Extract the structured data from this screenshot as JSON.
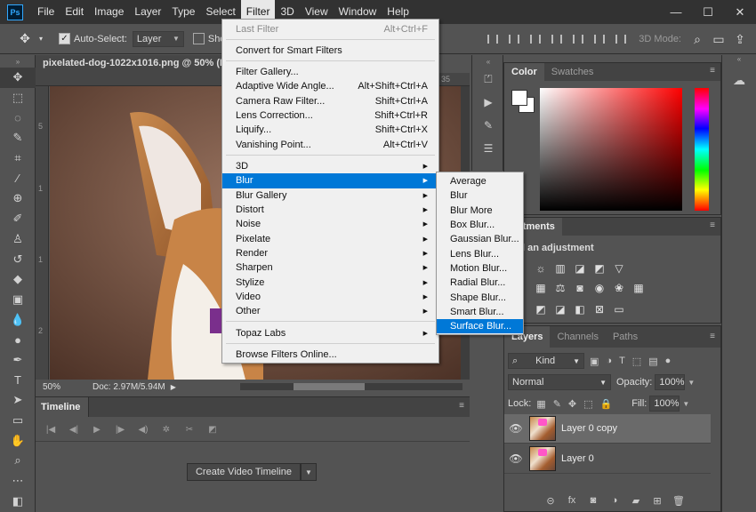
{
  "app": {
    "logo": "Ps"
  },
  "menubar": [
    "File",
    "Edit",
    "Image",
    "Layer",
    "Type",
    "Select",
    "Filter",
    "3D",
    "View",
    "Window",
    "Help"
  ],
  "window_controls": [
    "—",
    "☐",
    "✕"
  ],
  "options": {
    "autoselect_label": "Auto-Select:",
    "autoselect_value": "Layer",
    "show_label": "Show",
    "mode_label": "3D Mode:"
  },
  "document": {
    "tab_title": "pixelated-dog-1022x1016.png @ 50% (La",
    "ruler_top_num": "35",
    "ruler_left_nums": [
      "5",
      "1",
      "1",
      "2"
    ],
    "zoom": "50%",
    "doc_size": "Doc: 2.97M/5.94M"
  },
  "timeline": {
    "tab": "Timeline",
    "create_button": "Create Video Timeline"
  },
  "color_panel": {
    "tabs": [
      "Color",
      "Swatches"
    ]
  },
  "adjustments_panel": {
    "tab": "ustments",
    "hint": "l an adjustment"
  },
  "layers_panel": {
    "tabs": [
      "Layers",
      "Channels",
      "Paths"
    ],
    "kind_label": "Kind",
    "blend_mode": "Normal",
    "opacity_label": "Opacity:",
    "opacity_value": "100%",
    "lock_label": "Lock:",
    "fill_label": "Fill:",
    "fill_value": "100%",
    "layers": [
      {
        "name": "Layer 0 copy",
        "selected": true
      },
      {
        "name": "Layer 0",
        "selected": false
      }
    ]
  },
  "filter_menu": {
    "items": [
      {
        "label": "Last Filter",
        "shortcut": "Alt+Ctrl+F",
        "disabled": true
      },
      {
        "label": "Convert for Smart Filters",
        "shortcut": ""
      },
      {
        "label": "Filter Gallery...",
        "shortcut": ""
      },
      {
        "label": "Adaptive Wide Angle...",
        "shortcut": "Alt+Shift+Ctrl+A"
      },
      {
        "label": "Camera Raw Filter...",
        "shortcut": "Shift+Ctrl+A"
      },
      {
        "label": "Lens Correction...",
        "shortcut": "Shift+Ctrl+R"
      },
      {
        "label": "Liquify...",
        "shortcut": "Shift+Ctrl+X"
      },
      {
        "label": "Vanishing Point...",
        "shortcut": "Alt+Ctrl+V"
      },
      {
        "label": "3D",
        "submenu": true
      },
      {
        "label": "Blur",
        "submenu": true,
        "highlighted": true
      },
      {
        "label": "Blur Gallery",
        "submenu": true
      },
      {
        "label": "Distort",
        "submenu": true
      },
      {
        "label": "Noise",
        "submenu": true
      },
      {
        "label": "Pixelate",
        "submenu": true
      },
      {
        "label": "Render",
        "submenu": true
      },
      {
        "label": "Sharpen",
        "submenu": true
      },
      {
        "label": "Stylize",
        "submenu": true
      },
      {
        "label": "Video",
        "submenu": true
      },
      {
        "label": "Other",
        "submenu": true
      },
      {
        "label": "Topaz Labs",
        "submenu": true
      },
      {
        "label": "Browse Filters Online...",
        "shortcut": ""
      }
    ]
  },
  "blur_menu": {
    "items": [
      "Average",
      "Blur",
      "Blur More",
      "Box Blur...",
      "Gaussian Blur...",
      "Lens Blur...",
      "Motion Blur...",
      "Radial Blur...",
      "Shape Blur...",
      "Smart Blur...",
      "Surface Blur..."
    ],
    "highlighted_index": 10
  },
  "colors": {
    "highlight": "#0078d7",
    "menu_bg": "#f0f0f0",
    "ui_dark": "#323232",
    "ui_mid": "#535353"
  }
}
